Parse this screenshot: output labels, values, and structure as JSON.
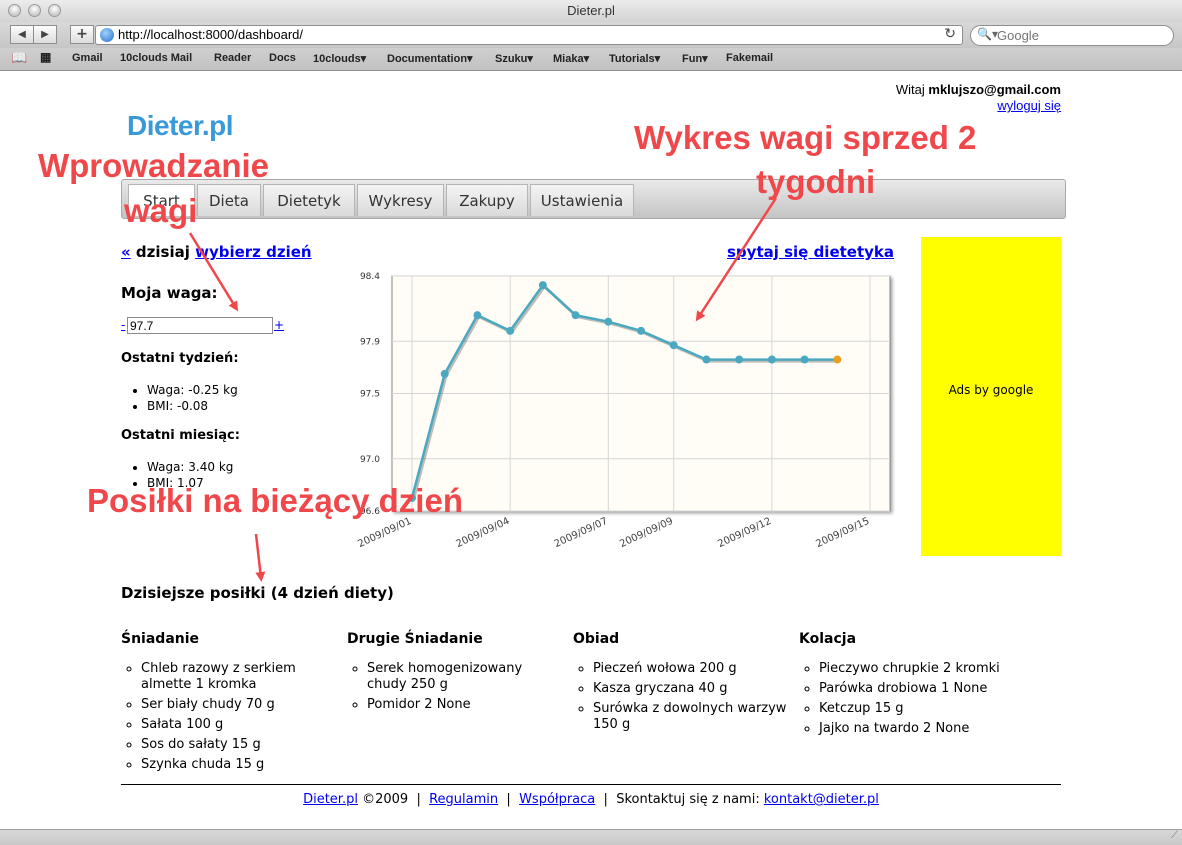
{
  "window": {
    "title": "Dieter.pl"
  },
  "toolbar": {
    "back_icon": "left-triangle-icon",
    "forward_icon": "right-triangle-icon",
    "add_icon": "plus-icon",
    "url": "http://localhost:8000/dashboard/",
    "search_placeholder": "Google"
  },
  "bookmarks": [
    "Gmail",
    "10clouds Mail",
    "Reader",
    "Docs",
    "10clouds▾",
    "Documentation▾",
    "Szuku▾",
    "Miaka▾",
    "Tutorials▾",
    "Fun▾",
    "Fakemail"
  ],
  "header": {
    "logo": "Dieter.pl",
    "welcome_prefix": "Witaj ",
    "user": "mklujszo@gmail.com",
    "logout": "wyloguj się"
  },
  "tabs": [
    "Start",
    "Dieta",
    "Dietetyk",
    "Wykresy",
    "Zakupy",
    "Ustawienia"
  ],
  "daynav": {
    "prev": "«",
    "today": " dzisiaj ",
    "pick": "wybierz dzień"
  },
  "ask_link": "spytaj się dietetyka",
  "weight": {
    "title": "Moja waga:",
    "minus": "-",
    "plus": "+",
    "value": "97.7"
  },
  "last_week": {
    "title": "Ostatni tydzień:",
    "items": [
      "Waga: -0.25 kg",
      "BMI: -0.08"
    ]
  },
  "last_month": {
    "title": "Ostatni miesiąc:",
    "items": [
      "Waga: 3.40 kg",
      "BMI: 1.07"
    ]
  },
  "ads": "Ads by google",
  "annotations": {
    "weight_input": [
      "Wprowadzanie",
      "wagi"
    ],
    "chart": [
      "Wykres wagi sprzed 2",
      "tygodni"
    ],
    "meals": "Posiłki na bieżący dzień",
    "color": "#f0474b"
  },
  "chart_data": {
    "type": "line",
    "x": [
      "2009/09/01",
      "2009/09/02",
      "2009/09/03",
      "2009/09/04",
      "2009/09/05",
      "2009/09/06",
      "2009/09/07",
      "2009/09/08",
      "2009/09/09",
      "2009/09/10",
      "2009/09/11",
      "2009/09/12",
      "2009/09/13",
      "2009/09/14"
    ],
    "values": [
      96.7,
      97.65,
      98.1,
      97.98,
      98.33,
      98.1,
      98.05,
      97.98,
      97.87,
      97.76,
      97.76,
      97.76,
      97.76,
      97.76
    ],
    "ytick_labels": [
      "98.4",
      "97.9",
      "97.5",
      "97.0",
      "96.6"
    ],
    "ytick_values": [
      98.4,
      97.9,
      97.5,
      97.0,
      96.6
    ],
    "xtick_labels": [
      "2009/09/01",
      "2009/09/04",
      "2009/09/07",
      "2009/09/09",
      "2009/09/12",
      "2009/09/15"
    ],
    "ylim": [
      96.6,
      98.4
    ],
    "grid": true,
    "line_color": "#4aa8c0",
    "last_point_color": "#e8a020",
    "background": "#fffdf5"
  },
  "meals": {
    "title": "Dzisiejsze posiłki (4 dzień diety)",
    "columns": [
      {
        "name": "Śniadanie",
        "items": [
          "Chleb razowy z serkiem almette 1 kromka",
          "Ser biały chudy 70 g",
          "Sałata 100 g",
          "Sos do sałaty 15 g",
          "Szynka chuda 15 g"
        ]
      },
      {
        "name": "Drugie Śniadanie",
        "items": [
          "Serek homogenizowany chudy 250 g",
          "Pomidor 2 None"
        ]
      },
      {
        "name": "Obiad",
        "items": [
          "Pieczeń wołowa 200 g",
          "Kasza gryczana 40 g",
          "Surówka z dowolnych warzyw 150 g"
        ]
      },
      {
        "name": "Kolacja",
        "items": [
          "Pieczywo chrupkie 2 kromki",
          "Parówka drobiowa 1 None",
          "Ketczup 15 g",
          "Jajko na twardo 2 None"
        ]
      }
    ]
  },
  "footer": {
    "brand": "Dieter.pl",
    "copy": " ©2009  |  ",
    "terms": "Regulamin",
    "sep": "  |  ",
    "coop": "Współpraca",
    "contact_text": "  |  Skontaktuj się z nami: ",
    "email": "kontakt@dieter.pl"
  }
}
